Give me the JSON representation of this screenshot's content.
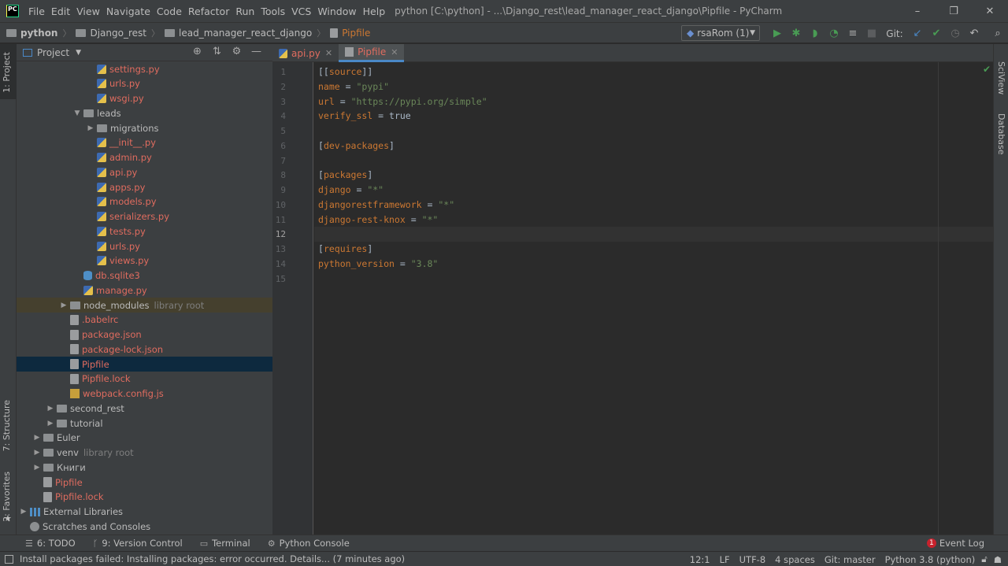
{
  "titlebar": {
    "menu": [
      "File",
      "Edit",
      "View",
      "Navigate",
      "Code",
      "Refactor",
      "Run",
      "Tools",
      "VCS",
      "Window",
      "Help"
    ],
    "window_title": "python [C:\\python] - ...\\Django_rest\\lead_manager_react_django\\Pipfile - PyCharm",
    "controls": [
      "–",
      "❐",
      "✕"
    ]
  },
  "navbar": {
    "breadcrumbs": [
      "python",
      "Django_rest",
      "lead_manager_react_django",
      "Pipfile"
    ],
    "run_config": "rsaRom (1)",
    "git_label": "Git:"
  },
  "left_strip": {
    "project_tab": "1: Project",
    "structure_tab": "7: Structure",
    "favorites_tab": "2: Favorites"
  },
  "right_strip": {
    "sciview_tab": "SciView",
    "database_tab": "Database"
  },
  "project_panel": {
    "title": "Project",
    "tree": [
      {
        "label": "settings.py",
        "indent": 6,
        "icon": "py",
        "color": "red",
        "arrow": ""
      },
      {
        "label": "urls.py",
        "indent": 6,
        "icon": "py",
        "color": "red",
        "arrow": ""
      },
      {
        "label": "wsgi.py",
        "indent": 6,
        "icon": "py",
        "color": "red",
        "arrow": ""
      },
      {
        "label": "leads",
        "indent": 5,
        "icon": "folder",
        "color": "",
        "arrow": "▼"
      },
      {
        "label": "migrations",
        "indent": 6,
        "icon": "folder",
        "color": "",
        "arrow": "▶"
      },
      {
        "label": "__init__.py",
        "indent": 6,
        "icon": "py",
        "color": "red",
        "arrow": ""
      },
      {
        "label": "admin.py",
        "indent": 6,
        "icon": "py",
        "color": "red",
        "arrow": ""
      },
      {
        "label": "api.py",
        "indent": 6,
        "icon": "py",
        "color": "red",
        "arrow": ""
      },
      {
        "label": "apps.py",
        "indent": 6,
        "icon": "py",
        "color": "red",
        "arrow": ""
      },
      {
        "label": "models.py",
        "indent": 6,
        "icon": "py",
        "color": "red",
        "arrow": ""
      },
      {
        "label": "serializers.py",
        "indent": 6,
        "icon": "py",
        "color": "red",
        "arrow": ""
      },
      {
        "label": "tests.py",
        "indent": 6,
        "icon": "py",
        "color": "red",
        "arrow": ""
      },
      {
        "label": "urls.py",
        "indent": 6,
        "icon": "py",
        "color": "red",
        "arrow": ""
      },
      {
        "label": "views.py",
        "indent": 6,
        "icon": "py",
        "color": "red",
        "arrow": ""
      },
      {
        "label": "db.sqlite3",
        "indent": 5,
        "icon": "db",
        "color": "red",
        "arrow": ""
      },
      {
        "label": "manage.py",
        "indent": 5,
        "icon": "py",
        "color": "red",
        "arrow": ""
      },
      {
        "label": "node_modules",
        "sub": "library root",
        "indent": 4,
        "icon": "folder",
        "color": "",
        "arrow": "▶",
        "row": "hl"
      },
      {
        "label": ".babelrc",
        "indent": 4,
        "icon": "file",
        "color": "red",
        "arrow": ""
      },
      {
        "label": "package.json",
        "indent": 4,
        "icon": "file",
        "color": "red",
        "arrow": ""
      },
      {
        "label": "package-lock.json",
        "indent": 4,
        "icon": "file",
        "color": "red",
        "arrow": ""
      },
      {
        "label": "Pipfile",
        "indent": 4,
        "icon": "file",
        "color": "red",
        "arrow": "",
        "row": "sel"
      },
      {
        "label": "Pipfile.lock",
        "indent": 4,
        "icon": "file",
        "color": "red",
        "arrow": ""
      },
      {
        "label": "webpack.config.js",
        "indent": 4,
        "icon": "js",
        "color": "red",
        "arrow": ""
      },
      {
        "label": "second_rest",
        "indent": 3,
        "icon": "folder",
        "color": "",
        "arrow": "▶"
      },
      {
        "label": "tutorial",
        "indent": 3,
        "icon": "folder",
        "color": "",
        "arrow": "▶"
      },
      {
        "label": "Euler",
        "indent": 2,
        "icon": "folder",
        "color": "",
        "arrow": "▶"
      },
      {
        "label": "venv",
        "sub": "library root",
        "indent": 2,
        "icon": "folder",
        "color": "",
        "arrow": "▶"
      },
      {
        "label": "Книги",
        "indent": 2,
        "icon": "folder",
        "color": "",
        "arrow": "▶"
      },
      {
        "label": "Pipfile",
        "indent": 2,
        "icon": "file",
        "color": "red",
        "arrow": ""
      },
      {
        "label": "Pipfile.lock",
        "indent": 2,
        "icon": "file",
        "color": "red",
        "arrow": ""
      },
      {
        "label": "External Libraries",
        "indent": 1,
        "icon": "lib",
        "color": "",
        "arrow": "▶"
      },
      {
        "label": "Scratches and Consoles",
        "indent": 1,
        "icon": "scratch",
        "color": "",
        "arrow": ""
      }
    ]
  },
  "editor": {
    "tabs": [
      {
        "label": "api.py",
        "active": false
      },
      {
        "label": "Pipfile",
        "active": true
      }
    ],
    "current_line": 12,
    "lines": [
      [
        {
          "t": "[[",
          "c": "sec"
        },
        {
          "t": "source",
          "c": "kw"
        },
        {
          "t": "]]",
          "c": "sec"
        }
      ],
      [
        {
          "t": "name",
          "c": "kw"
        },
        {
          "t": " = ",
          "c": "sec"
        },
        {
          "t": "\"pypi\"",
          "c": "str"
        }
      ],
      [
        {
          "t": "url",
          "c": "kw"
        },
        {
          "t": " = ",
          "c": "sec"
        },
        {
          "t": "\"https://pypi.org/simple\"",
          "c": "str"
        }
      ],
      [
        {
          "t": "verify_ssl",
          "c": "kw"
        },
        {
          "t": " = ",
          "c": "sec"
        },
        {
          "t": "true",
          "c": "sec"
        }
      ],
      [],
      [
        {
          "t": "[",
          "c": "sec"
        },
        {
          "t": "dev-packages",
          "c": "kw"
        },
        {
          "t": "]",
          "c": "sec"
        }
      ],
      [],
      [
        {
          "t": "[",
          "c": "sec"
        },
        {
          "t": "packages",
          "c": "kw"
        },
        {
          "t": "]",
          "c": "sec"
        }
      ],
      [
        {
          "t": "django",
          "c": "kw"
        },
        {
          "t": " = ",
          "c": "sec"
        },
        {
          "t": "\"*\"",
          "c": "str"
        }
      ],
      [
        {
          "t": "djangorestframework",
          "c": "kw"
        },
        {
          "t": " = ",
          "c": "sec"
        },
        {
          "t": "\"*\"",
          "c": "str"
        }
      ],
      [
        {
          "t": "django-rest-knox",
          "c": "kw"
        },
        {
          "t": " = ",
          "c": "sec"
        },
        {
          "t": "\"*\"",
          "c": "str"
        }
      ],
      [],
      [
        {
          "t": "[",
          "c": "sec"
        },
        {
          "t": "requires",
          "c": "kw"
        },
        {
          "t": "]",
          "c": "sec"
        }
      ],
      [
        {
          "t": "python_version",
          "c": "kw"
        },
        {
          "t": " = ",
          "c": "sec"
        },
        {
          "t": "\"3.8\"",
          "c": "str"
        }
      ],
      []
    ]
  },
  "bottom_tabs": [
    {
      "label": "6: TODO",
      "icon": "☰"
    },
    {
      "label": "9: Version Control",
      "icon": "ᚴ"
    },
    {
      "label": "Terminal",
      "icon": "▭"
    },
    {
      "label": "Python Console",
      "icon": "⚙"
    }
  ],
  "event_log": {
    "label": "Event Log",
    "count": "1"
  },
  "statusbar": {
    "message": "Install packages failed: Installing packages: error occurred. Details... (7 minutes ago)",
    "position": "12:1",
    "line_sep": "LF",
    "encoding": "UTF-8",
    "indent": "4 spaces",
    "git_branch": "Git: master",
    "interpreter": "Python 3.8 (python)"
  }
}
